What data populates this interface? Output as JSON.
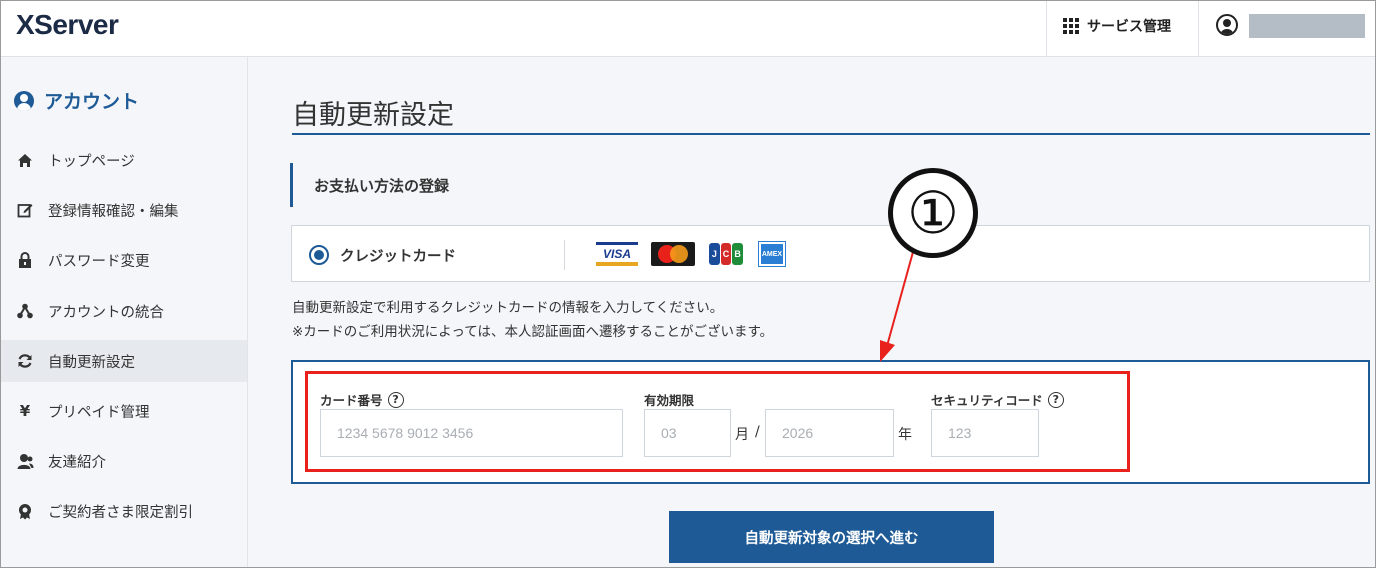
{
  "header": {
    "logo": "XServer",
    "service_label": "サービス管理"
  },
  "sidebar": {
    "title": "アカウント",
    "items": [
      {
        "label": "トップページ",
        "icon": "home-icon"
      },
      {
        "label": "登録情報確認・編集",
        "icon": "edit-icon"
      },
      {
        "label": "パスワード変更",
        "icon": "lock-icon"
      },
      {
        "label": "アカウントの統合",
        "icon": "merge-icon"
      },
      {
        "label": "自動更新設定",
        "icon": "refresh-icon",
        "active": true
      },
      {
        "label": "プリペイド管理",
        "icon": "yen-icon"
      },
      {
        "label": "友達紹介",
        "icon": "friend-icon"
      },
      {
        "label": "ご契約者さま限定割引",
        "icon": "badge-icon"
      }
    ]
  },
  "main": {
    "title": "自動更新設定",
    "section_title": "お支払い方法の登録",
    "payment_option": "クレジットカード",
    "card_brands": [
      "VISA",
      "Mastercard",
      "JCB",
      "AMEX"
    ],
    "notes": [
      "自動更新設定で利用するクレジットカードの情報を入力してください。",
      "※カードのご利用状況によっては、本人認証画面へ遷移することがございます。"
    ],
    "form": {
      "card_number_label": "カード番号",
      "card_number_placeholder": "1234 5678 9012 3456",
      "expiry_label": "有効期限",
      "month_placeholder": "03",
      "month_unit": "月",
      "slash": "/",
      "year_placeholder": "2026",
      "year_unit": "年",
      "cvc_label": "セキュリティコード",
      "cvc_placeholder": "123"
    },
    "submit_label": "自動更新対象の選択へ進む"
  },
  "annotation": {
    "marker": "①",
    "color": "#e8211d"
  },
  "colors": {
    "accent": "#1e5a96",
    "highlight": "#e8211d"
  }
}
